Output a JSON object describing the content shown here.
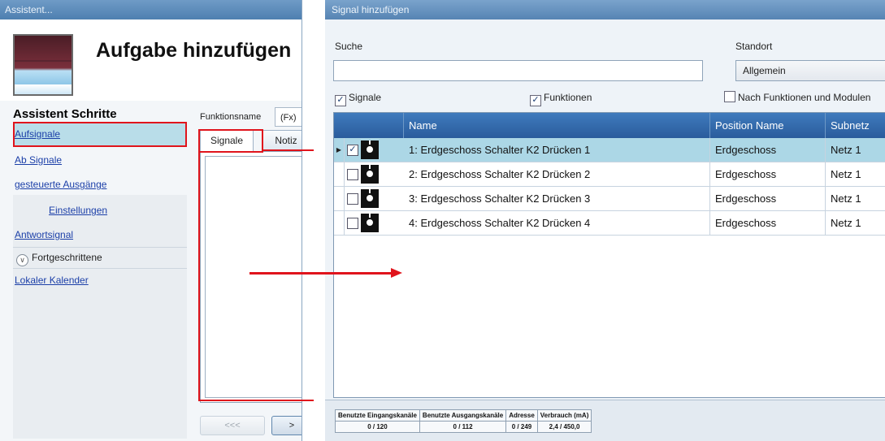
{
  "left_window": {
    "title": "Assistent...",
    "heading": "Aufgabe hinzufügen",
    "steps_title": "Assistent Schritte",
    "nav": {
      "aufsignale": "Aufsignale",
      "ab_signale": "Ab Signale",
      "gesteuerte_ausgaenge": "gesteuerte Ausgänge",
      "einstellungen": "Einstellungen",
      "antwortsignal": "Antwortsignal",
      "fortgeschrittene": "Fortgeschrittene",
      "lokaler_kalender": "Lokaler Kalender"
    },
    "function_name_label": "Funktionsname",
    "function_name_value": "(Fx)",
    "tabs": {
      "signale": "Signale",
      "notiz": "Notiz"
    },
    "prev_button": "<<<",
    "next_button": ">"
  },
  "right_window": {
    "title": "Signal hinzufügen",
    "search_label": "Suche",
    "search_value": "",
    "location_label": "Standort",
    "location_value": "Allgemein",
    "filters": {
      "signale": "Signale",
      "funktionen": "Funktionen",
      "nach_funktionen": "Nach Funktionen und Modulen"
    },
    "columns": {
      "name": "Name",
      "position": "Position Name",
      "subnet": "Subnetz"
    },
    "rows": [
      {
        "name": "1: Erdgeschoss Schalter K2 Drücken 1",
        "position": "Erdgeschoss",
        "subnet": "Netz 1",
        "checked": true,
        "selected": true
      },
      {
        "name": "2: Erdgeschoss Schalter K2 Drücken 2",
        "position": "Erdgeschoss",
        "subnet": "Netz 1",
        "checked": false,
        "selected": false
      },
      {
        "name": "3: Erdgeschoss Schalter K2 Drücken 3",
        "position": "Erdgeschoss",
        "subnet": "Netz 1",
        "checked": false,
        "selected": false
      },
      {
        "name": "4: Erdgeschoss Schalter K2 Drücken 4",
        "position": "Erdgeschoss",
        "subnet": "Netz 1",
        "checked": false,
        "selected": false
      }
    ],
    "stats": {
      "headers": [
        "Benutzte Eingangskanäle",
        "Benutzte Ausgangskanäle",
        "Adresse",
        "Verbrauch (mA)"
      ],
      "values": [
        "0 / 120",
        "0 / 112",
        "0 / 249",
        "2,4 / 450,0"
      ]
    }
  },
  "colors": {
    "annotation_red": "#e0141c",
    "header_blue": "#2a5c9c",
    "selection": "#acd7e6"
  }
}
